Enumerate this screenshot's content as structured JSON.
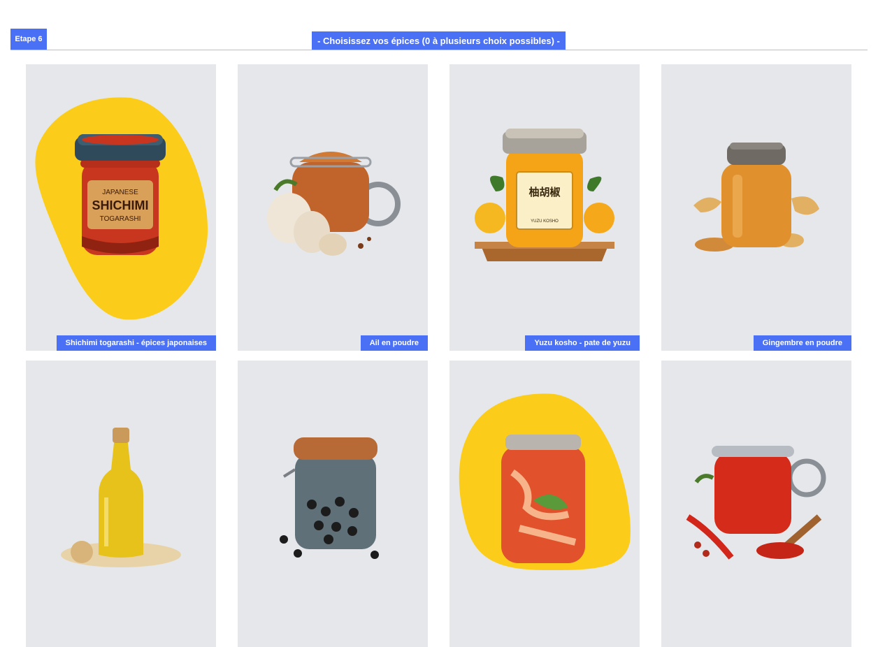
{
  "header": {
    "step_label": "Etape 6",
    "title": "- Choisissez vos épices (0 à plusieurs choix possibles) -"
  },
  "cards": [
    {
      "label": "Shichimi togarashi - épices japonaises",
      "selected": true,
      "jar_text_top": "JAPANESE",
      "jar_text_main": "SHICHIMI",
      "jar_text_sub": "TOGARASHI",
      "icon": "shichimi-jar-icon"
    },
    {
      "label": "Ail en poudre",
      "selected": false,
      "icon": "garlic-powder-jar-icon"
    },
    {
      "label": "Yuzu kosho - pate de yuzu",
      "selected": false,
      "jar_text_main": "柚胡椒",
      "jar_text_sub": "YUZU KOSHO",
      "icon": "yuzu-kosho-jar-icon"
    },
    {
      "label": "Gingembre en poudre",
      "selected": false,
      "icon": "ginger-powder-jar-icon"
    },
    {
      "label": "",
      "selected": false,
      "icon": "sesame-oil-bottle-icon"
    },
    {
      "label": "",
      "selected": false,
      "icon": "black-pepper-jar-icon"
    },
    {
      "label": "",
      "selected": true,
      "icon": "kimchi-jar-icon"
    },
    {
      "label": "",
      "selected": false,
      "icon": "chili-powder-jar-icon"
    }
  ],
  "colors": {
    "accent": "#4a70f5",
    "selected_blob": "#fbcd1a",
    "card_background": "#e5e7eb"
  }
}
